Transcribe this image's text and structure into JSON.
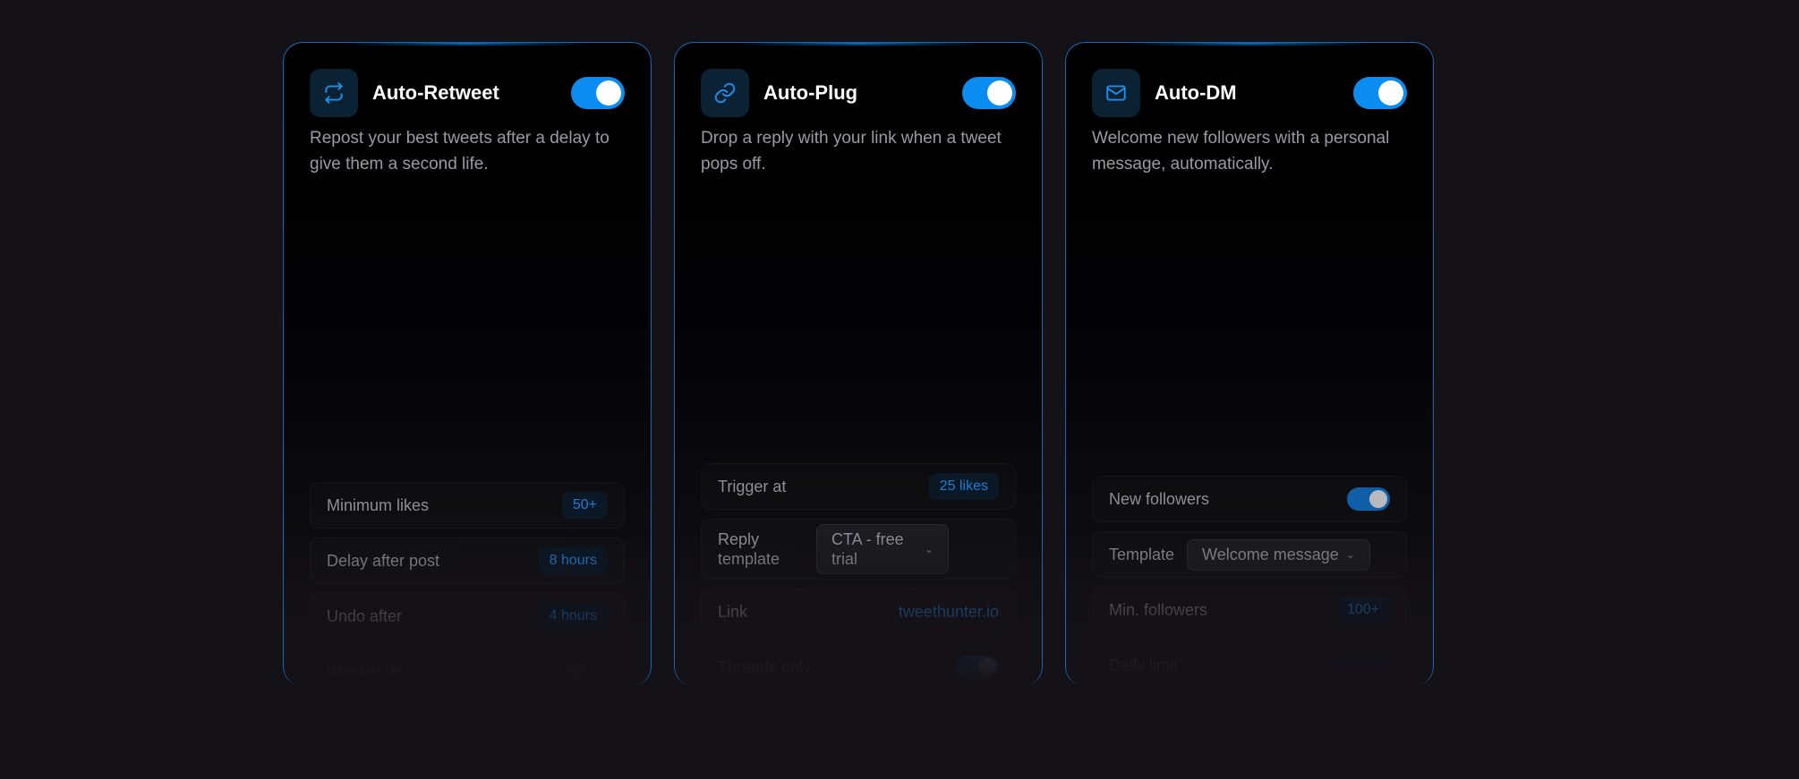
{
  "colors": {
    "background": "#141217",
    "accent": "#0b8cf0",
    "link": "#1f7ed2",
    "border": "#1878d2"
  },
  "cards": [
    {
      "title": "Auto-Retweet",
      "icon": "repeat-icon",
      "enabled": true,
      "description": "Repost your best tweets after a delay to give them a second life.",
      "settings": {
        "min_likes_label": "Minimum likes",
        "min_likes_value": "50+",
        "delay_label": "Delay after post",
        "delay_value": "8 hours",
        "undo_label": "Undo after",
        "undo_value": "4 hours",
        "weekends_label": "Weekends"
      }
    },
    {
      "title": "Auto-Plug",
      "icon": "link-icon",
      "enabled": true,
      "description": "Drop a reply with your link when a tweet pops off.",
      "settings": {
        "trigger_label": "Trigger at",
        "trigger_value": "25 likes",
        "template_label": "Reply template",
        "template_value": "CTA - free trial",
        "link_label": "Link",
        "link_value": "tweethunter.io",
        "threads_label": "Threads only",
        "threads_enabled": true
      }
    },
    {
      "title": "Auto-DM",
      "icon": "mail-icon",
      "enabled": true,
      "description": "Welcome new followers with a personal message, automatically.",
      "settings": {
        "new_followers_label": "New followers",
        "new_followers_enabled": true,
        "template_label": "Template",
        "template_value": "Welcome message",
        "min_followers_label": "Min. followers",
        "min_followers_value": "100+",
        "daily_limit_label": "Daily limit"
      }
    }
  ]
}
